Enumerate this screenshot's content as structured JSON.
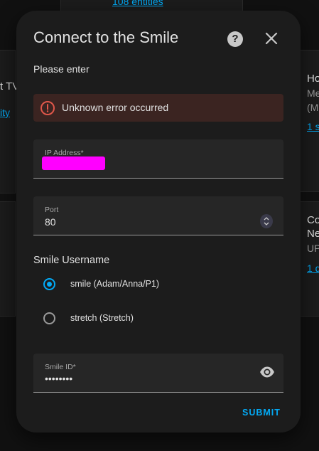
{
  "background": {
    "top_link": "108 entities",
    "left_card_title": "t TV",
    "left_card_link": "ity",
    "right_card1_title": "Ho",
    "right_card1_sub1": "Me",
    "right_card1_sub2": "(M",
    "right_card1_link": "1 s",
    "right_card2_title1": "Co",
    "right_card2_title2": "Ne",
    "right_card2_sub": "UP",
    "right_card2_link": "1 d"
  },
  "dialog": {
    "title": "Connect to the Smile",
    "help_icon": "?",
    "intro": "Please enter",
    "error": {
      "message": "Unknown error occurred"
    },
    "ip_field": {
      "label": "IP Address*",
      "value": ""
    },
    "port_field": {
      "label": "Port",
      "value": "80"
    },
    "username": {
      "label": "Smile Username",
      "options": [
        {
          "label": "smile (Adam/Anna/P1)",
          "selected": true
        },
        {
          "label": "stretch (Stretch)",
          "selected": false
        }
      ]
    },
    "smile_id_field": {
      "label": "Smile ID*",
      "value": "••••••••"
    },
    "submit_label": "SUBMIT"
  },
  "colors": {
    "accent": "#03a9f4",
    "error_icon": "#e0574a",
    "error_bg": "#3b2421",
    "redaction": "#ff00ff"
  }
}
